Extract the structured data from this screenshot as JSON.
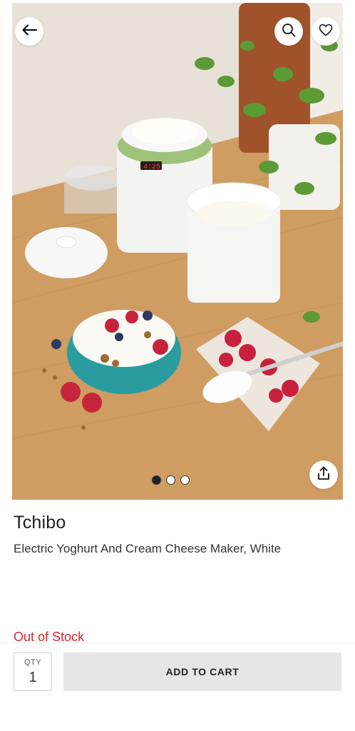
{
  "product": {
    "brand": "Tchibo",
    "title": "Electric Yoghurt And Cream Cheese Maker, White",
    "stock_status": "Out of Stock",
    "image_alt": "Product photo: yoghurt maker with bowls of yoghurt and berries",
    "display_readout": "4:25"
  },
  "carousel": {
    "total": 3,
    "active": 1
  },
  "cart": {
    "qty_label": "QTY",
    "qty_value": "1",
    "add_label": "ADD TO CART"
  },
  "colors": {
    "out_of_stock": "#d7262a",
    "button_bg": "#e6e6e6"
  },
  "icons": {
    "back": "arrow-left-icon",
    "search": "search-icon",
    "wishlist": "heart-icon",
    "share": "share-icon"
  }
}
